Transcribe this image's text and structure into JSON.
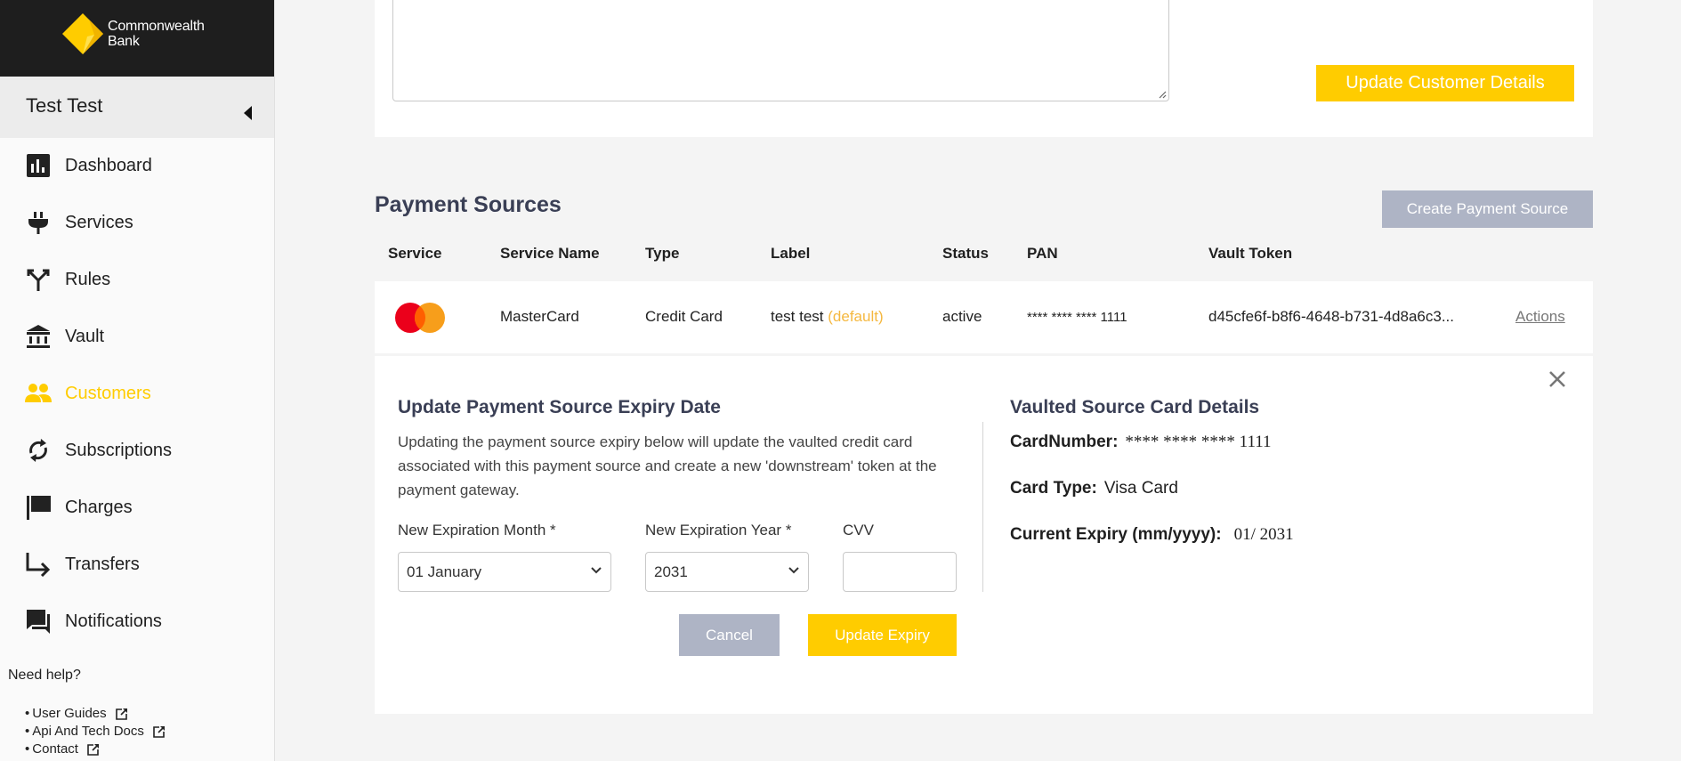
{
  "brand": {
    "line1": "Commonwealth",
    "line2": "Bank",
    "accent": "#ffcc00"
  },
  "sidebar": {
    "user_name": "Test Test",
    "items": [
      {
        "label": "Dashboard",
        "icon": "bar-chart-icon",
        "active": false
      },
      {
        "label": "Services",
        "icon": "plug-icon",
        "active": false
      },
      {
        "label": "Rules",
        "icon": "split-arrows-icon",
        "active": false
      },
      {
        "label": "Vault",
        "icon": "bank-icon",
        "active": false
      },
      {
        "label": "Customers",
        "icon": "people-icon",
        "active": true
      },
      {
        "label": "Subscriptions",
        "icon": "refresh-icon",
        "active": false
      },
      {
        "label": "Charges",
        "icon": "flag-icon",
        "active": false
      },
      {
        "label": "Transfers",
        "icon": "turn-right-arrow-icon",
        "active": false
      },
      {
        "label": "Notifications",
        "icon": "chat-icon",
        "active": false
      }
    ],
    "help": {
      "title": "Need help?",
      "links": [
        "User Guides",
        "Api And Tech Docs",
        "Contact"
      ]
    }
  },
  "customer_card": {
    "notes_value": "",
    "update_button": "Update Customer Details"
  },
  "payment_sources": {
    "title": "Payment Sources",
    "create_button": "Create Payment Source",
    "columns": [
      "Service",
      "Service Name",
      "Type",
      "Label",
      "Status",
      "PAN",
      "Vault Token"
    ],
    "rows": [
      {
        "service_icon": "mastercard-logo",
        "service_name": "MasterCard",
        "type": "Credit Card",
        "label": "test test",
        "label_badge": "(default)",
        "status": "active",
        "pan": "**** **** **** 1111",
        "vault_token": "d45cfe6f-b8f6-4648-b731-4d8a6c3...",
        "actions": "Actions"
      }
    ]
  },
  "expiry_form": {
    "title": "Update Payment Source Expiry Date",
    "description": "Updating the payment source expiry below will update the vaulted credit card associated with this payment source and create a new 'downstream' token at the payment gateway.",
    "month_label": "New Expiration Month *",
    "month_value": "01 January",
    "year_label": "New Expiration Year *",
    "year_value": "2031",
    "cvv_label": "CVV",
    "cvv_value": "",
    "cancel_button": "Cancel",
    "submit_button": "Update Expiry"
  },
  "vaulted_details": {
    "title": "Vaulted Source Card Details",
    "card_number_label": "CardNumber:",
    "card_number_value": "**** **** **** 1111",
    "card_type_label": "Card Type:",
    "card_type_value": "Visa Card",
    "expiry_label": "Current Expiry (mm/yyyy):",
    "expiry_value": "01/ 2031"
  }
}
